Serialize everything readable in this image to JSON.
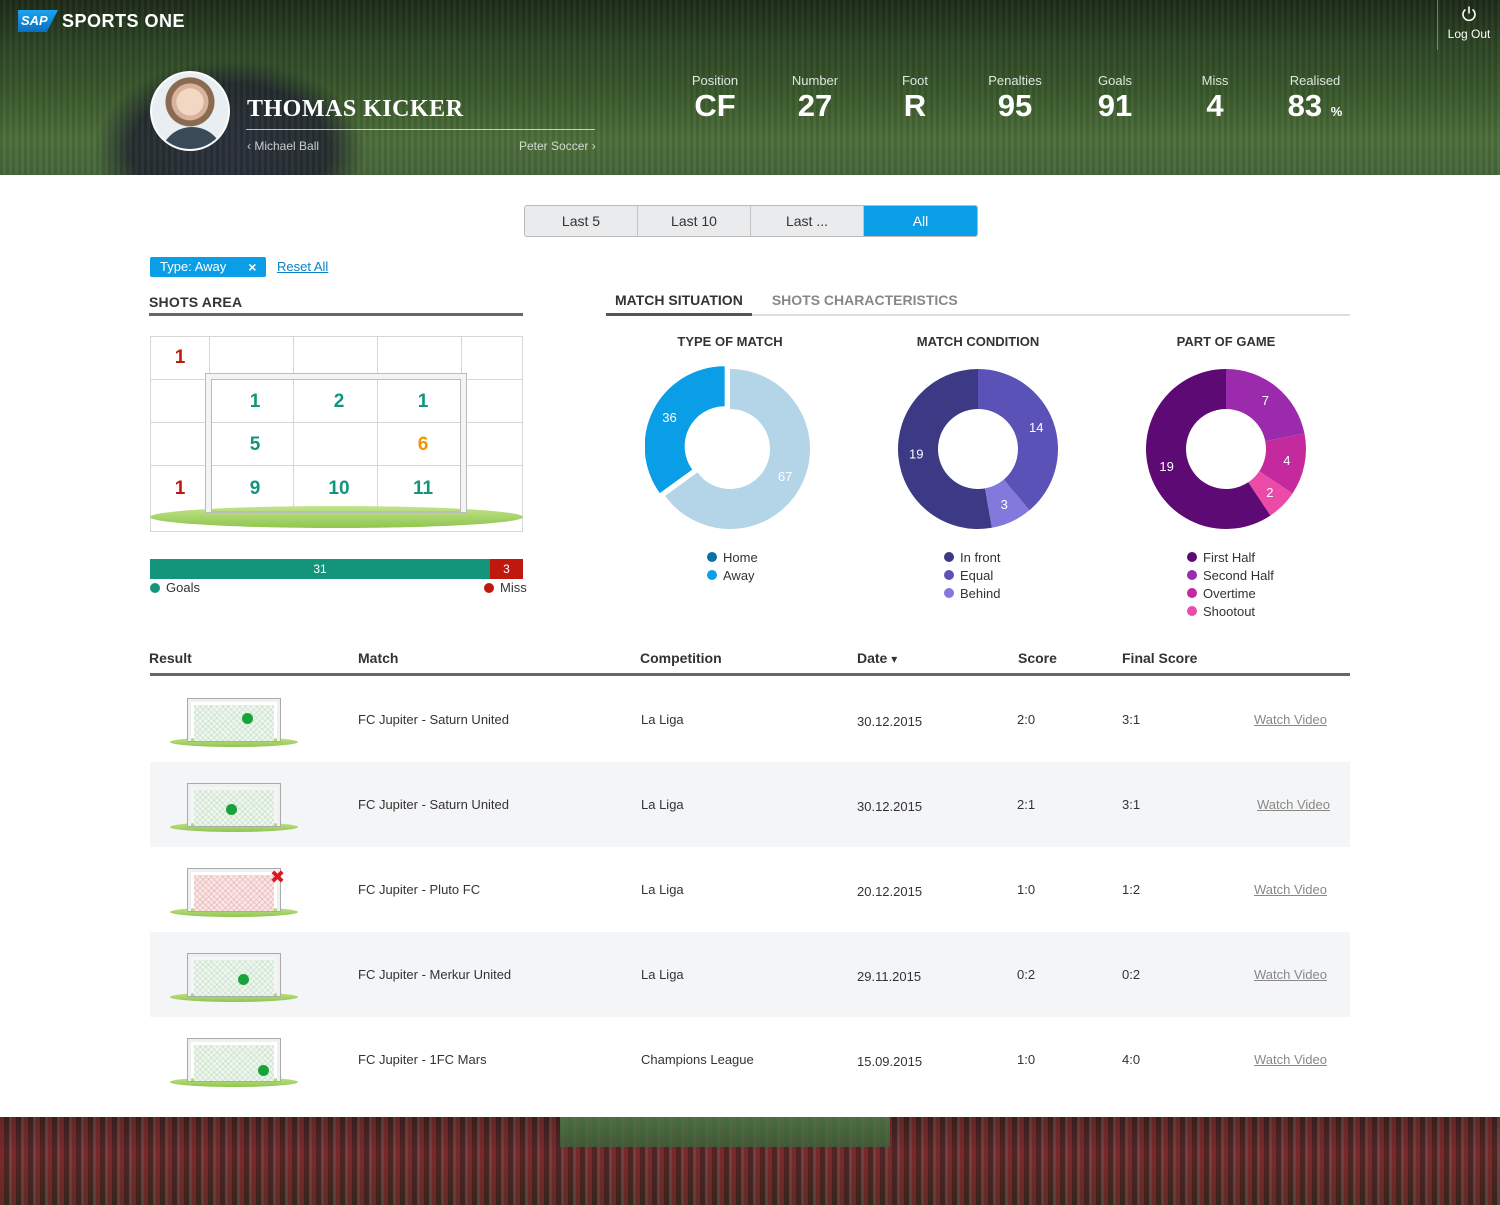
{
  "app": {
    "brand_short": "SAP",
    "brand_name": "SPORTS ONE",
    "logout_label": "Log Out"
  },
  "player": {
    "name": "THOMAS KICKER",
    "prev_player": "‹ Michael Ball",
    "next_player": "Peter Soccer ›"
  },
  "stats": [
    {
      "label": "Position",
      "value": "CF",
      "unit": ""
    },
    {
      "label": "Number",
      "value": "27",
      "unit": ""
    },
    {
      "label": "Foot",
      "value": "R",
      "unit": ""
    },
    {
      "label": "Penalties",
      "value": "95",
      "unit": ""
    },
    {
      "label": "Goals",
      "value": "91",
      "unit": ""
    },
    {
      "label": "Miss",
      "value": "4",
      "unit": ""
    },
    {
      "label": "Realised",
      "value": "83",
      "unit": "%"
    }
  ],
  "range_filter": {
    "options": [
      "Last 5",
      "Last 10",
      "Last ...",
      "All"
    ],
    "selected": "All"
  },
  "active_filter": {
    "chip_label": "Type: Away",
    "chip_close": "×",
    "reset_label": "Reset All"
  },
  "shots_area": {
    "title": "SHOTS AREA",
    "cells": [
      {
        "value": "1",
        "color": "#c0170f"
      },
      {
        "value": "1",
        "color": "#12957b"
      },
      {
        "value": "2",
        "color": "#12957b"
      },
      {
        "value": "1",
        "color": "#12957b"
      },
      {
        "value": "5",
        "color": "#12957b"
      },
      {
        "value": "6",
        "color": "#f39500"
      },
      {
        "value": "1",
        "color": "#c0170f"
      },
      {
        "value": "9",
        "color": "#12957b"
      },
      {
        "value": "10",
        "color": "#12957b"
      },
      {
        "value": "11",
        "color": "#12957b"
      }
    ],
    "goals_count": "31",
    "miss_count": "3",
    "goals_label": "Goals",
    "miss_label": "Miss",
    "colors": {
      "goals": "#12957b",
      "miss": "#c0170f"
    }
  },
  "tabs": {
    "match_situation": "MATCH SITUATION",
    "shots_characteristics": "SHOTS CHARACTERISTICS",
    "active": "MATCH SITUATION"
  },
  "donuts": [
    {
      "title": "TYPE OF MATCH",
      "slices": [
        {
          "label": "Home",
          "value": 36,
          "color": "#0a9ee6"
        },
        {
          "label": "Away",
          "value": 67,
          "color": "#b4d4e8"
        }
      ],
      "legend": [
        {
          "label": "Home",
          "color": "#0b6fa8"
        },
        {
          "label": "Away",
          "color": "#0a9ee6"
        }
      ]
    },
    {
      "title": "MATCH CONDITION",
      "slices": [
        {
          "label": "In front",
          "value": 19,
          "color": "#3c3a84"
        },
        {
          "label": "Equal",
          "value": 14,
          "color": "#5b52b8"
        },
        {
          "label": "Behind",
          "value": 3,
          "color": "#8378dc"
        }
      ],
      "legend": [
        {
          "label": "In front",
          "color": "#3c3a84"
        },
        {
          "label": "Equal",
          "color": "#5b52b8"
        },
        {
          "label": "Behind",
          "color": "#8378dc"
        }
      ]
    },
    {
      "title": "PART OF GAME",
      "slices": [
        {
          "label": "First Half",
          "value": 19,
          "color": "#5e0a74"
        },
        {
          "label": "Second Half",
          "value": 7,
          "color": "#9b2aad"
        },
        {
          "label": "Overtime",
          "value": 4,
          "color": "#c42a9e"
        },
        {
          "label": "Shootout",
          "value": 2,
          "color": "#ec4aa8"
        }
      ],
      "legend": [
        {
          "label": "First Half",
          "color": "#5e0a74"
        },
        {
          "label": "Second Half",
          "color": "#9b2aad"
        },
        {
          "label": "Overtime",
          "color": "#c42a9e"
        },
        {
          "label": "Shootout",
          "color": "#ec4aa8"
        }
      ]
    }
  ],
  "table": {
    "headers": {
      "result": "Result",
      "match": "Match",
      "competition": "Competition",
      "date": "Date",
      "sort_icon": "▾",
      "score": "Score",
      "final_score": "Final Score"
    },
    "rows": [
      {
        "outcome": "goal",
        "match": "FC Jupiter - Saturn United",
        "competition": "La Liga",
        "date": "30.12.2015",
        "score": "2:0",
        "final_score": "3:1",
        "link": "Watch Video"
      },
      {
        "outcome": "goal",
        "match": "FC Jupiter - Saturn United",
        "competition": "La Liga",
        "date": "30.12.2015",
        "score": "2:1",
        "final_score": "3:1",
        "link": "Watch Video"
      },
      {
        "outcome": "miss",
        "match": "FC Jupiter - Pluto FC",
        "competition": "La Liga",
        "date": "20.12.2015",
        "score": "1:0",
        "final_score": "1:2",
        "link": "Watch Video"
      },
      {
        "outcome": "goal",
        "match": "FC Jupiter - Merkur United",
        "competition": "La Liga",
        "date": "29.11.2015",
        "score": "0:2",
        "final_score": "0:2",
        "link": "Watch Video"
      },
      {
        "outcome": "goal",
        "match": "FC Jupiter - 1FC Mars",
        "competition": "Champions League",
        "date": "15.09.2015",
        "score": "1:0",
        "final_score": "4:0",
        "link": "Watch Video"
      }
    ]
  }
}
